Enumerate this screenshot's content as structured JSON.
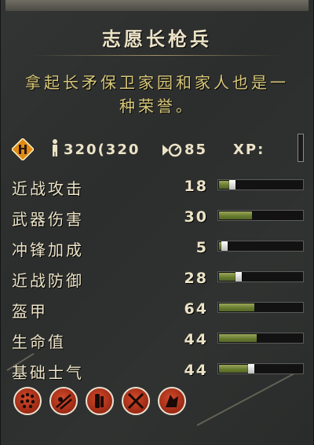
{
  "unit": {
    "name": "志愿长枪兵",
    "description": "拿起长矛保卫家园和家人也是一种荣誉。"
  },
  "infobar": {
    "faction_icon": "faction-emblem-icon",
    "soldiers_icon": "soldier-icon",
    "soldiers": "320(320",
    "speed_icon": "speed-icon",
    "speed": "85",
    "xp_label": "XP:"
  },
  "stats": [
    {
      "label": "近战攻击",
      "value": "18",
      "fill": 0.12
    },
    {
      "label": "武器伤害",
      "value": "30",
      "fill": 0.4
    },
    {
      "label": "冲锋加成",
      "value": "5",
      "fill": 0.03
    },
    {
      "label": "近战防御",
      "value": "28",
      "fill": 0.2
    },
    {
      "label": "盔甲",
      "value": "64",
      "fill": 0.42
    },
    {
      "label": "生命值",
      "value": "44",
      "fill": 0.45
    },
    {
      "label": "基础士气",
      "value": "44",
      "fill": 0.35
    }
  ],
  "abilities": [
    {
      "icon": "formation-icon"
    },
    {
      "icon": "spear-wall-icon"
    },
    {
      "icon": "brace-icon"
    },
    {
      "icon": "anti-cavalry-icon"
    },
    {
      "icon": "guard-mode-icon"
    }
  ],
  "colors": {
    "panel": "#2c2e2d",
    "text": "#ece3c7",
    "description": "#d9c87a",
    "bar_fill": "#667a2e",
    "ability": "#b13a20",
    "faction": "#e08a14"
  }
}
